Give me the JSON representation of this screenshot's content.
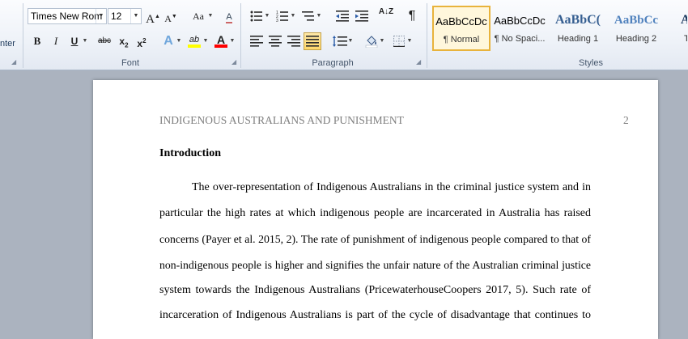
{
  "ribbon": {
    "clipboard_fragment": "nter",
    "font": {
      "label": "Font",
      "family": "Times New Rom",
      "size": "12",
      "grow_label": "A",
      "shrink_label": "A",
      "case_label": "Aa",
      "clear_label": "A",
      "bold_label": "B",
      "italic_label": "I",
      "underline_label": "U",
      "strike_label": "abc",
      "sub_label": "x",
      "sub_suffix": "2",
      "sup_label": "x",
      "sup_suffix": "2",
      "effects_label": "A",
      "highlight_label": "ab",
      "fontcolor_label": "A",
      "highlight_color": "#ffff00",
      "fontcolor_color": "#ff0000"
    },
    "paragraph": {
      "label": "Paragraph",
      "pilcrow": "¶",
      "sort_label": "A↓Z"
    },
    "styles": {
      "label": "Styles",
      "items": [
        {
          "sample": "AaBbCcDc",
          "name": "¶ Normal"
        },
        {
          "sample": "AaBbCcDc",
          "name": "¶ No Spaci..."
        },
        {
          "sample": "AaBbC(",
          "name": "Heading 1"
        },
        {
          "sample": "AaBbCc",
          "name": "Heading 2"
        },
        {
          "sample": "A",
          "name": "T"
        }
      ]
    }
  },
  "document": {
    "running_head": "INDIGENOUS AUSTRALIANS AND PUNISHMENT",
    "page_number": "2",
    "heading": "Introduction",
    "lines": [
      "The over-representation of Indigenous Australians in the criminal justice system and in",
      "particular the high rates at which indigenous people are incarcerated in Australia has raised",
      "concerns (Payer et al. 2015, 2). The rate of punishment of indigenous people compared to that of",
      "non-indigenous people is higher and signifies the unfair nature of the Australian criminal justice",
      "system towards the Indigenous Australians (PricewaterhouseCoopers 2017, 5). Such rate of",
      "incarceration of Indigenous Australians is part of the cycle of disadvantage that continues to"
    ]
  }
}
